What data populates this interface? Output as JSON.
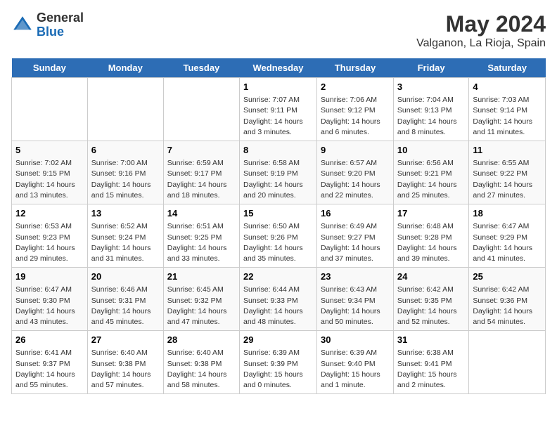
{
  "header": {
    "logo_general": "General",
    "logo_blue": "Blue",
    "title": "May 2024",
    "subtitle": "Valganon, La Rioja, Spain"
  },
  "days": [
    "Sunday",
    "Monday",
    "Tuesday",
    "Wednesday",
    "Thursday",
    "Friday",
    "Saturday"
  ],
  "weeks": [
    [
      {
        "date": "",
        "text": ""
      },
      {
        "date": "",
        "text": ""
      },
      {
        "date": "",
        "text": ""
      },
      {
        "date": "1",
        "text": "Sunrise: 7:07 AM\nSunset: 9:11 PM\nDaylight: 14 hours\nand 3 minutes."
      },
      {
        "date": "2",
        "text": "Sunrise: 7:06 AM\nSunset: 9:12 PM\nDaylight: 14 hours\nand 6 minutes."
      },
      {
        "date": "3",
        "text": "Sunrise: 7:04 AM\nSunset: 9:13 PM\nDaylight: 14 hours\nand 8 minutes."
      },
      {
        "date": "4",
        "text": "Sunrise: 7:03 AM\nSunset: 9:14 PM\nDaylight: 14 hours\nand 11 minutes."
      }
    ],
    [
      {
        "date": "5",
        "text": "Sunrise: 7:02 AM\nSunset: 9:15 PM\nDaylight: 14 hours\nand 13 minutes."
      },
      {
        "date": "6",
        "text": "Sunrise: 7:00 AM\nSunset: 9:16 PM\nDaylight: 14 hours\nand 15 minutes."
      },
      {
        "date": "7",
        "text": "Sunrise: 6:59 AM\nSunset: 9:17 PM\nDaylight: 14 hours\nand 18 minutes."
      },
      {
        "date": "8",
        "text": "Sunrise: 6:58 AM\nSunset: 9:19 PM\nDaylight: 14 hours\nand 20 minutes."
      },
      {
        "date": "9",
        "text": "Sunrise: 6:57 AM\nSunset: 9:20 PM\nDaylight: 14 hours\nand 22 minutes."
      },
      {
        "date": "10",
        "text": "Sunrise: 6:56 AM\nSunset: 9:21 PM\nDaylight: 14 hours\nand 25 minutes."
      },
      {
        "date": "11",
        "text": "Sunrise: 6:55 AM\nSunset: 9:22 PM\nDaylight: 14 hours\nand 27 minutes."
      }
    ],
    [
      {
        "date": "12",
        "text": "Sunrise: 6:53 AM\nSunset: 9:23 PM\nDaylight: 14 hours\nand 29 minutes."
      },
      {
        "date": "13",
        "text": "Sunrise: 6:52 AM\nSunset: 9:24 PM\nDaylight: 14 hours\nand 31 minutes."
      },
      {
        "date": "14",
        "text": "Sunrise: 6:51 AM\nSunset: 9:25 PM\nDaylight: 14 hours\nand 33 minutes."
      },
      {
        "date": "15",
        "text": "Sunrise: 6:50 AM\nSunset: 9:26 PM\nDaylight: 14 hours\nand 35 minutes."
      },
      {
        "date": "16",
        "text": "Sunrise: 6:49 AM\nSunset: 9:27 PM\nDaylight: 14 hours\nand 37 minutes."
      },
      {
        "date": "17",
        "text": "Sunrise: 6:48 AM\nSunset: 9:28 PM\nDaylight: 14 hours\nand 39 minutes."
      },
      {
        "date": "18",
        "text": "Sunrise: 6:47 AM\nSunset: 9:29 PM\nDaylight: 14 hours\nand 41 minutes."
      }
    ],
    [
      {
        "date": "19",
        "text": "Sunrise: 6:47 AM\nSunset: 9:30 PM\nDaylight: 14 hours\nand 43 minutes."
      },
      {
        "date": "20",
        "text": "Sunrise: 6:46 AM\nSunset: 9:31 PM\nDaylight: 14 hours\nand 45 minutes."
      },
      {
        "date": "21",
        "text": "Sunrise: 6:45 AM\nSunset: 9:32 PM\nDaylight: 14 hours\nand 47 minutes."
      },
      {
        "date": "22",
        "text": "Sunrise: 6:44 AM\nSunset: 9:33 PM\nDaylight: 14 hours\nand 48 minutes."
      },
      {
        "date": "23",
        "text": "Sunrise: 6:43 AM\nSunset: 9:34 PM\nDaylight: 14 hours\nand 50 minutes."
      },
      {
        "date": "24",
        "text": "Sunrise: 6:42 AM\nSunset: 9:35 PM\nDaylight: 14 hours\nand 52 minutes."
      },
      {
        "date": "25",
        "text": "Sunrise: 6:42 AM\nSunset: 9:36 PM\nDaylight: 14 hours\nand 54 minutes."
      }
    ],
    [
      {
        "date": "26",
        "text": "Sunrise: 6:41 AM\nSunset: 9:37 PM\nDaylight: 14 hours\nand 55 minutes."
      },
      {
        "date": "27",
        "text": "Sunrise: 6:40 AM\nSunset: 9:38 PM\nDaylight: 14 hours\nand 57 minutes."
      },
      {
        "date": "28",
        "text": "Sunrise: 6:40 AM\nSunset: 9:38 PM\nDaylight: 14 hours\nand 58 minutes."
      },
      {
        "date": "29",
        "text": "Sunrise: 6:39 AM\nSunset: 9:39 PM\nDaylight: 15 hours\nand 0 minutes."
      },
      {
        "date": "30",
        "text": "Sunrise: 6:39 AM\nSunset: 9:40 PM\nDaylight: 15 hours\nand 1 minute."
      },
      {
        "date": "31",
        "text": "Sunrise: 6:38 AM\nSunset: 9:41 PM\nDaylight: 15 hours\nand 2 minutes."
      },
      {
        "date": "",
        "text": ""
      }
    ]
  ]
}
